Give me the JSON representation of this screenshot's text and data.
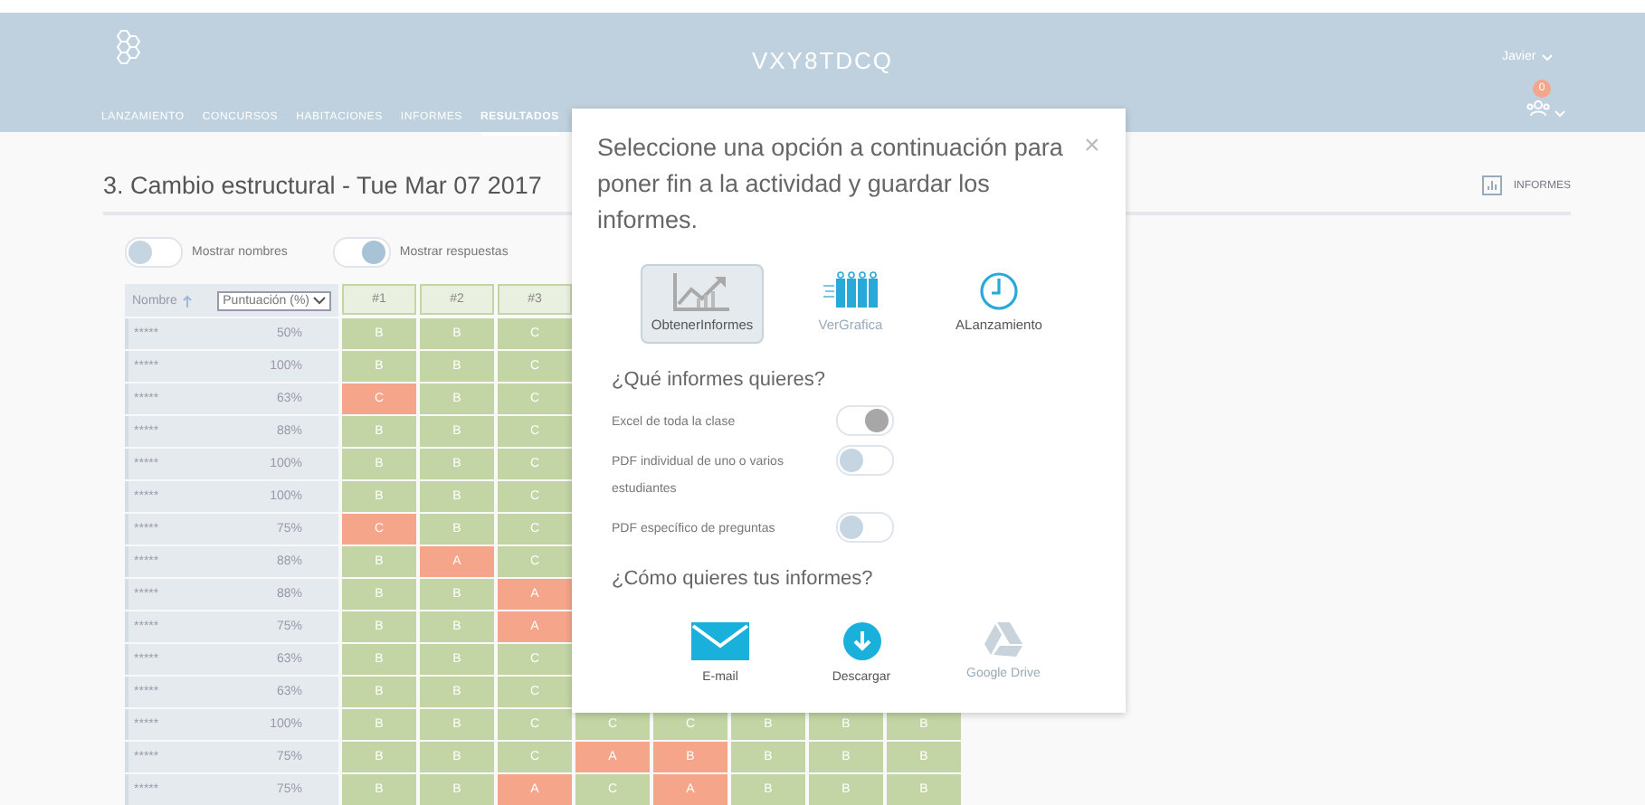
{
  "header": {
    "title": "VXY8TDCQ",
    "user": "Javier",
    "notification_count": "0",
    "nav": [
      {
        "label": "LANZAMIENTO",
        "selected": false
      },
      {
        "label": "CONCURSOS",
        "selected": false
      },
      {
        "label": "HABITACIONES",
        "selected": false
      },
      {
        "label": "INFORMES",
        "selected": false
      },
      {
        "label": "RESULTADOS",
        "selected": true
      }
    ]
  },
  "page": {
    "title": "3. Cambio estructural - Tue Mar 07 2017",
    "reports_button": "INFORMES",
    "toggles": [
      {
        "label": "Mostrar nombres",
        "on": false
      },
      {
        "label": "Mostrar respuestas",
        "on": true
      }
    ]
  },
  "table": {
    "name_header": "Nombre",
    "sort_select": "Puntuación (%)",
    "columns": [
      "#1",
      "#2",
      "#3"
    ],
    "rows": [
      {
        "name": "*****",
        "score": "50%",
        "answers": [
          {
            "letter": "B",
            "correct": true
          },
          {
            "letter": "B",
            "correct": true
          },
          {
            "letter": "C",
            "correct": true
          }
        ]
      },
      {
        "name": "*****",
        "score": "100%",
        "answers": [
          {
            "letter": "B",
            "correct": true
          },
          {
            "letter": "B",
            "correct": true
          },
          {
            "letter": "C",
            "correct": true
          }
        ]
      },
      {
        "name": "*****",
        "score": "63%",
        "answers": [
          {
            "letter": "C",
            "correct": false
          },
          {
            "letter": "B",
            "correct": true
          },
          {
            "letter": "C",
            "correct": true
          }
        ]
      },
      {
        "name": "*****",
        "score": "88%",
        "answers": [
          {
            "letter": "B",
            "correct": true
          },
          {
            "letter": "B",
            "correct": true
          },
          {
            "letter": "C",
            "correct": true
          }
        ]
      },
      {
        "name": "*****",
        "score": "100%",
        "answers": [
          {
            "letter": "B",
            "correct": true
          },
          {
            "letter": "B",
            "correct": true
          },
          {
            "letter": "C",
            "correct": true
          }
        ]
      },
      {
        "name": "*****",
        "score": "100%",
        "answers": [
          {
            "letter": "B",
            "correct": true
          },
          {
            "letter": "B",
            "correct": true
          },
          {
            "letter": "C",
            "correct": true
          }
        ]
      },
      {
        "name": "*****",
        "score": "75%",
        "answers": [
          {
            "letter": "C",
            "correct": false
          },
          {
            "letter": "B",
            "correct": true
          },
          {
            "letter": "C",
            "correct": true
          }
        ]
      },
      {
        "name": "*****",
        "score": "88%",
        "answers": [
          {
            "letter": "B",
            "correct": true
          },
          {
            "letter": "A",
            "correct": false
          },
          {
            "letter": "C",
            "correct": true
          }
        ]
      },
      {
        "name": "*****",
        "score": "88%",
        "answers": [
          {
            "letter": "B",
            "correct": true
          },
          {
            "letter": "B",
            "correct": true
          },
          {
            "letter": "A",
            "correct": false
          }
        ]
      },
      {
        "name": "*****",
        "score": "75%",
        "answers": [
          {
            "letter": "B",
            "correct": true
          },
          {
            "letter": "B",
            "correct": true
          },
          {
            "letter": "A",
            "correct": false
          }
        ]
      },
      {
        "name": "*****",
        "score": "63%",
        "answers": [
          {
            "letter": "B",
            "correct": true
          },
          {
            "letter": "B",
            "correct": true
          },
          {
            "letter": "C",
            "correct": true
          }
        ]
      },
      {
        "name": "*****",
        "score": "63%",
        "answers": [
          {
            "letter": "B",
            "correct": true
          },
          {
            "letter": "B",
            "correct": true
          },
          {
            "letter": "C",
            "correct": true
          }
        ]
      },
      {
        "name": "*****",
        "score": "100%",
        "answers": [
          {
            "letter": "B",
            "correct": true
          },
          {
            "letter": "B",
            "correct": true
          },
          {
            "letter": "C",
            "correct": true
          },
          {
            "letter": "C",
            "correct": true
          },
          {
            "letter": "C",
            "correct": true
          },
          {
            "letter": "B",
            "correct": true
          },
          {
            "letter": "B",
            "correct": true
          },
          {
            "letter": "B",
            "correct": true
          }
        ]
      },
      {
        "name": "*****",
        "score": "75%",
        "answers": [
          {
            "letter": "B",
            "correct": true
          },
          {
            "letter": "B",
            "correct": true
          },
          {
            "letter": "C",
            "correct": true
          },
          {
            "letter": "A",
            "correct": false
          },
          {
            "letter": "B",
            "correct": false
          },
          {
            "letter": "B",
            "correct": true
          },
          {
            "letter": "B",
            "correct": true
          },
          {
            "letter": "B",
            "correct": true
          }
        ]
      },
      {
        "name": "*****",
        "score": "75%",
        "answers": [
          {
            "letter": "B",
            "correct": true
          },
          {
            "letter": "B",
            "correct": true
          },
          {
            "letter": "A",
            "correct": false
          },
          {
            "letter": "C",
            "correct": true
          },
          {
            "letter": "A",
            "correct": false
          },
          {
            "letter": "B",
            "correct": true
          },
          {
            "letter": "B",
            "correct": true
          },
          {
            "letter": "B",
            "correct": true
          }
        ]
      }
    ]
  },
  "dialog": {
    "message": "Seleccione una opción a continuación para poner fin a la actividad y guardar los informes.",
    "close": "×",
    "options": [
      {
        "kind": "reports",
        "label": "ObtenerInformes",
        "selected": true
      },
      {
        "kind": "graph",
        "label": "VerGrafica",
        "selected": false
      },
      {
        "kind": "launch",
        "label": "ALanzamiento",
        "selected": false
      }
    ],
    "reports_heading": "¿Qué informes quieres?",
    "report_toggles": [
      {
        "label": "Excel de toda la clase",
        "on": true
      },
      {
        "label": "PDF individual de uno o varios estudiantes",
        "on": false
      },
      {
        "label": "PDF específico de preguntas",
        "on": false
      }
    ],
    "delivery_heading": "¿Cómo quieres tus informes?",
    "delivery": [
      {
        "kind": "email",
        "label": "E-mail",
        "disabled": false
      },
      {
        "kind": "download",
        "label": "Descargar",
        "disabled": false
      },
      {
        "kind": "drive",
        "label": "Google Drive",
        "disabled": true
      }
    ]
  }
}
